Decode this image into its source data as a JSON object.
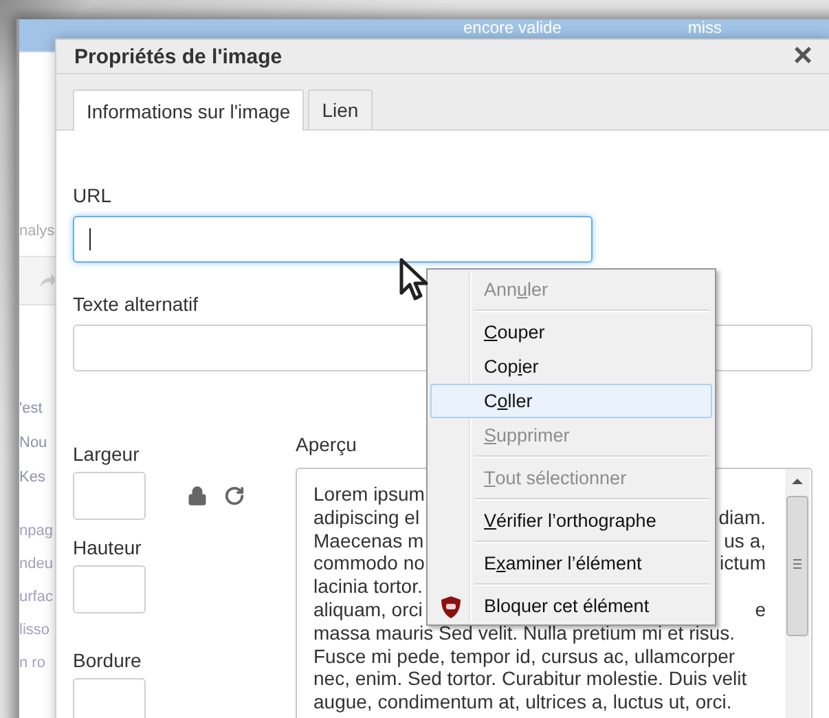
{
  "background_page": {
    "header_cells": [
      "encore valide",
      "miss"
    ],
    "sidebar_top": "nalys",
    "sidebar_groups": [
      [
        "'est",
        "Nou",
        "Kes"
      ],
      [
        "npag",
        "ndeu",
        "urfac",
        "lisso",
        "n ro"
      ]
    ]
  },
  "dialog": {
    "title": "Propriétés de l'image",
    "close": "×",
    "tabs": [
      {
        "label": "Informations sur l'image",
        "selected": true
      },
      {
        "label": "Lien",
        "selected": false
      }
    ],
    "url": {
      "label": "URL",
      "focused": true
    },
    "alt": {
      "label": "Texte alternatif",
      "focused": false
    },
    "width": {
      "label": "Largeur"
    },
    "height": {
      "label": "Hauteur"
    },
    "border": {
      "label": "Bordure"
    },
    "preview": {
      "label": "Aperçu",
      "lines": [
        {
          "left": "Lorem ipsum"
        },
        {
          "left": "adipiscing el",
          "right": "diam."
        },
        {
          "left": "Maecenas m",
          "right": "us a,"
        },
        {
          "left": "commodo no",
          "right": "ictum"
        },
        {
          "left": "lacinia tortor."
        },
        {
          "left": "aliquam, orci",
          "right": "e"
        },
        {
          "left": "massa mauris Sed velit. Nulla pretium mi et risus."
        },
        {
          "left": "Fusce mi pede, tempor id, cursus ac, ullamcorper"
        },
        {
          "left": "nec, enim. Sed tortor. Curabitur molestie. Duis velit"
        },
        {
          "left": "augue, condimentum at, ultrices a, luctus ut, orci."
        }
      ]
    }
  },
  "context_menu": [
    {
      "kind": "item",
      "before": "Ann",
      "key": "u",
      "after": "ler",
      "disabled": true,
      "selected": false
    },
    {
      "kind": "separator"
    },
    {
      "kind": "item",
      "key": "C",
      "after": "ouper",
      "disabled": false,
      "selected": false
    },
    {
      "kind": "item",
      "before": "Cop",
      "key": "i",
      "after": "er",
      "disabled": false,
      "selected": false
    },
    {
      "kind": "item",
      "before": "C",
      "key": "o",
      "after": "ller",
      "disabled": false,
      "selected": true
    },
    {
      "kind": "item",
      "key": "S",
      "after": "upprimer",
      "disabled": true,
      "selected": false
    },
    {
      "kind": "separator"
    },
    {
      "kind": "item",
      "key": "T",
      "after": "out sélectionner",
      "disabled": true,
      "selected": false
    },
    {
      "kind": "separator"
    },
    {
      "kind": "item",
      "key": "V",
      "after": "érifier l’orthographe",
      "disabled": false,
      "selected": false
    },
    {
      "kind": "separator"
    },
    {
      "kind": "item",
      "before": "E",
      "key": "x",
      "after": "aminer l’élément",
      "disabled": false,
      "selected": false
    },
    {
      "kind": "separator"
    },
    {
      "kind": "extension",
      "before": "Bloquer cet élément",
      "disabled": false,
      "selected": false
    }
  ]
}
